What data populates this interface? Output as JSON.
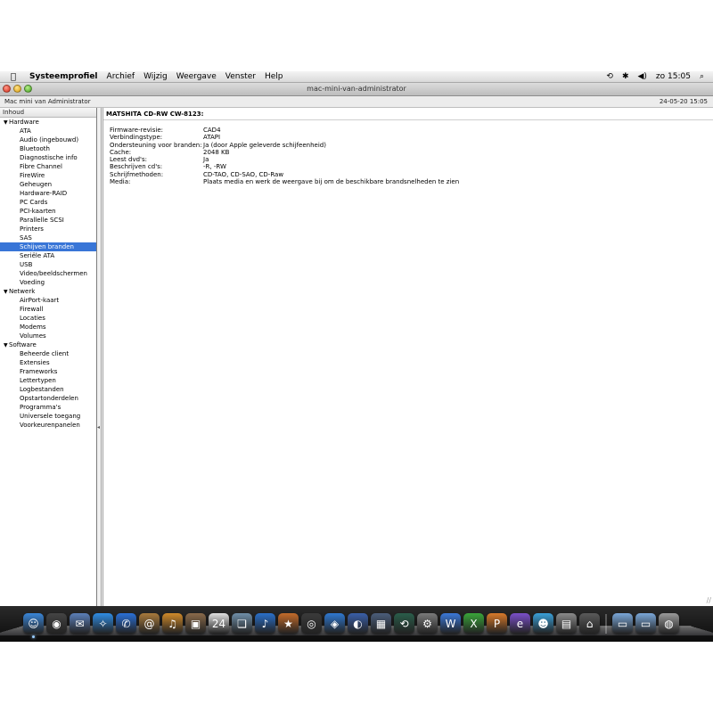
{
  "menubar": {
    "app_name": "Systeemprofiel",
    "menus": [
      "Archief",
      "Wijzig",
      "Weergave",
      "Venster",
      "Help"
    ],
    "clock": "zo 15:05"
  },
  "window": {
    "title": "mac-mini-van-administrator",
    "computer_name": "Mac mini van Administrator",
    "date": "24-05-20 15:05"
  },
  "sidebar": {
    "header": "Inhoud",
    "groups": [
      {
        "label": "Hardware",
        "items": [
          "ATA",
          "Audio (ingebouwd)",
          "Bluetooth",
          "Diagnostische info",
          "Fibre Channel",
          "FireWire",
          "Geheugen",
          "Hardware-RAID",
          "PC Cards",
          "PCI-kaarten",
          "Parallelle SCSI",
          "Printers",
          "SAS",
          "Schijven branden",
          "Seriële ATA",
          "USB",
          "Video/beeldschermen",
          "Voeding"
        ]
      },
      {
        "label": "Netwerk",
        "items": [
          "AirPort-kaart",
          "Firewall",
          "Locaties",
          "Modems",
          "Volumes"
        ]
      },
      {
        "label": "Software",
        "items": [
          "Beheerde client",
          "Extensies",
          "Frameworks",
          "Lettertypen",
          "Logbestanden",
          "Opstartonderdelen",
          "Programma's",
          "Universele toegang",
          "Voorkeurenpanelen"
        ]
      }
    ],
    "selected": "Schijven branden"
  },
  "content": {
    "device_title": "MATSHITA CD-RW  CW-8123:",
    "properties": [
      {
        "key": "Firmware-revisie:",
        "value": "CAD4"
      },
      {
        "key": "Verbindingstype:",
        "value": "ATAPI"
      },
      {
        "key": "Ondersteuning voor branden:",
        "value": "Ja (door Apple geleverde schijfeenheid)"
      },
      {
        "key": "Cache:",
        "value": "2048 KB"
      },
      {
        "key": "Leest dvd's:",
        "value": "Ja"
      },
      {
        "key": "Beschrijven cd's:",
        "value": "-R, -RW"
      },
      {
        "key": "Schrijfmethoden:",
        "value": "CD-TAO, CD-SAO, CD-Raw"
      },
      {
        "key": "Media:",
        "value": "Plaats media en werk de weergave bij om de beschikbare brandsnelheden te zien"
      }
    ]
  },
  "dock": {
    "icons": [
      {
        "name": "finder-icon",
        "glyph": "☺",
        "color": "#3a86d8"
      },
      {
        "name": "dashboard-icon",
        "glyph": "◉",
        "color": "#444444"
      },
      {
        "name": "mail-icon",
        "glyph": "✉",
        "color": "#5b7fb8"
      },
      {
        "name": "safari-icon",
        "glyph": "✧",
        "color": "#2f8de4"
      },
      {
        "name": "ichat-icon",
        "glyph": "✆",
        "color": "#2a6fd6"
      },
      {
        "name": "address-book-icon",
        "glyph": "@",
        "color": "#a87a3c"
      },
      {
        "name": "garageband-icon",
        "glyph": "♫",
        "color": "#d08a2a"
      },
      {
        "name": "iphoto-icon",
        "glyph": "▣",
        "color": "#8a6a4a"
      },
      {
        "name": "ical-icon",
        "glyph": "24",
        "color": "#e0e0e0"
      },
      {
        "name": "preview-icon",
        "glyph": "❏",
        "color": "#6f8fa8"
      },
      {
        "name": "itunes-icon",
        "glyph": "♪",
        "color": "#2a6fc9"
      },
      {
        "name": "imovie-icon",
        "glyph": "★",
        "color": "#c36b2a"
      },
      {
        "name": "dvd-player-icon",
        "glyph": "◎",
        "color": "#3b3b3b"
      },
      {
        "name": "iweb-icon",
        "glyph": "◈",
        "color": "#2f78d0"
      },
      {
        "name": "idvd-icon",
        "glyph": "◐",
        "color": "#3a5fa8"
      },
      {
        "name": "spaces-icon",
        "glyph": "▦",
        "color": "#4b5d7a"
      },
      {
        "name": "time-machine-icon",
        "glyph": "⟲",
        "color": "#2a5d4a"
      },
      {
        "name": "system-preferences-icon",
        "glyph": "⚙",
        "color": "#7a7a7a"
      },
      {
        "name": "word-icon",
        "glyph": "W",
        "color": "#3b78d8"
      },
      {
        "name": "excel-icon",
        "glyph": "X",
        "color": "#3aa53a"
      },
      {
        "name": "powerpoint-icon",
        "glyph": "P",
        "color": "#d8792a"
      },
      {
        "name": "entourage-icon",
        "glyph": "e",
        "color": "#7a4fc9"
      },
      {
        "name": "messenger-icon",
        "glyph": "☻",
        "color": "#3aa0d8"
      },
      {
        "name": "system-profiler-icon",
        "glyph": "▤",
        "color": "#8a8a8a"
      },
      {
        "name": "directory-utility-icon",
        "glyph": "⌂",
        "color": "#5a5a5a"
      },
      {
        "name": "applications-folder-icon",
        "glyph": "▭",
        "color": "#7aa7d8"
      },
      {
        "name": "documents-folder-icon",
        "glyph": "▭",
        "color": "#7aa7d8"
      },
      {
        "name": "trash-icon",
        "glyph": "◍",
        "color": "#9a9a9a"
      }
    ]
  }
}
